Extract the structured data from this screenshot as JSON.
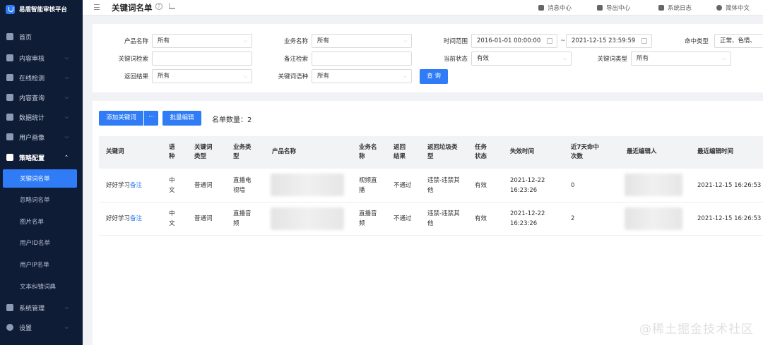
{
  "app": {
    "title": "易盾智能审核平台",
    "logo_icon": "shield-logo-icon"
  },
  "sidebar": {
    "items": [
      {
        "label": "首页",
        "icon": "grid-icon"
      },
      {
        "label": "内容审核",
        "icon": "user-card-icon"
      },
      {
        "label": "在线检测",
        "icon": "monitor-icon"
      },
      {
        "label": "内容查询",
        "icon": "search-doc-icon"
      },
      {
        "label": "数据统计",
        "icon": "pie-chart-icon"
      },
      {
        "label": "用户画像",
        "icon": "user-icon"
      },
      {
        "label": "策略配置",
        "icon": "briefcase-icon"
      }
    ],
    "sub_items": [
      "关键词名单",
      "忽略词名单",
      "图片名单",
      "用户ID名单",
      "用户IP名单",
      "文本纠错词典"
    ],
    "bottom_items": [
      {
        "label": "系统管理",
        "icon": "system-icon"
      },
      {
        "label": "设置",
        "icon": "gear-icon"
      }
    ]
  },
  "header": {
    "page_title": "关键词名单",
    "help": "?",
    "links": [
      {
        "label": "消息中心",
        "icon": "bell-icon"
      },
      {
        "label": "导出中心",
        "icon": "cloud-icon"
      },
      {
        "label": "系统日志",
        "icon": "log-icon"
      },
      {
        "label": "简体中文",
        "icon": "globe-icon"
      }
    ]
  },
  "filters": {
    "product_label": "产品名称",
    "product_value": "所有",
    "business_label": "业务名称",
    "business_value": "所有",
    "time_label": "时间范围",
    "time_start": "2016-01-01 00:00:00",
    "time_sep": "~",
    "time_end": "2021-12-15 23:59:59",
    "hit_label": "命中类型",
    "hit_value": "正常、色情、",
    "keyword_label": "关键词检索",
    "keyword_value": "",
    "remark_label": "备注检索",
    "remark_value": "",
    "status_label": "当前状态",
    "status_value": "有效",
    "kwtype_label": "关键词类型",
    "kwtype_value": "所有",
    "result_label": "返回结果",
    "result_value": "所有",
    "lang_label": "关键词语种",
    "lang_value": "所有",
    "query_button": "查 询"
  },
  "toolbar": {
    "add_button": "添加关键词",
    "more_button": "···",
    "batch_button": "批量编辑",
    "count_label": "名单数量：",
    "count_value": "2"
  },
  "table": {
    "headers": [
      "关键词",
      "语种",
      "关键词类型",
      "业务类型",
      "产品名称",
      "业务名称",
      "返回结果",
      "返回垃圾类型",
      "任务状态",
      "失效时间",
      "近7天命中次数",
      "最近编辑人",
      "最近编辑时间"
    ],
    "rows": [
      {
        "keyword": "好好学习",
        "remark": "备注",
        "lang": "中文",
        "kwtype": "普通词",
        "biztype": "直播电视墙",
        "bizname": "视频直播",
        "result": "不通过",
        "spam": "违禁-违禁其他",
        "status": "有效",
        "expire": "2021-12-22 16:23:26",
        "hits": "0",
        "edit_time": "2021-12-15 16:26:53"
      },
      {
        "keyword": "好好学习",
        "remark": "备注",
        "lang": "中文",
        "kwtype": "普通词",
        "biztype": "直播音频",
        "bizname": "直播音频",
        "result": "不通过",
        "spam": "违禁-违禁其他",
        "status": "有效",
        "expire": "2021-12-22 16:23:26",
        "hits": "2",
        "edit_time": "2021-12-15 16:26:53"
      }
    ]
  },
  "watermark": "@稀土掘金技术社区",
  "colors": {
    "sidebar_bg": "#0f1c36",
    "accent": "#2f7cf6"
  }
}
